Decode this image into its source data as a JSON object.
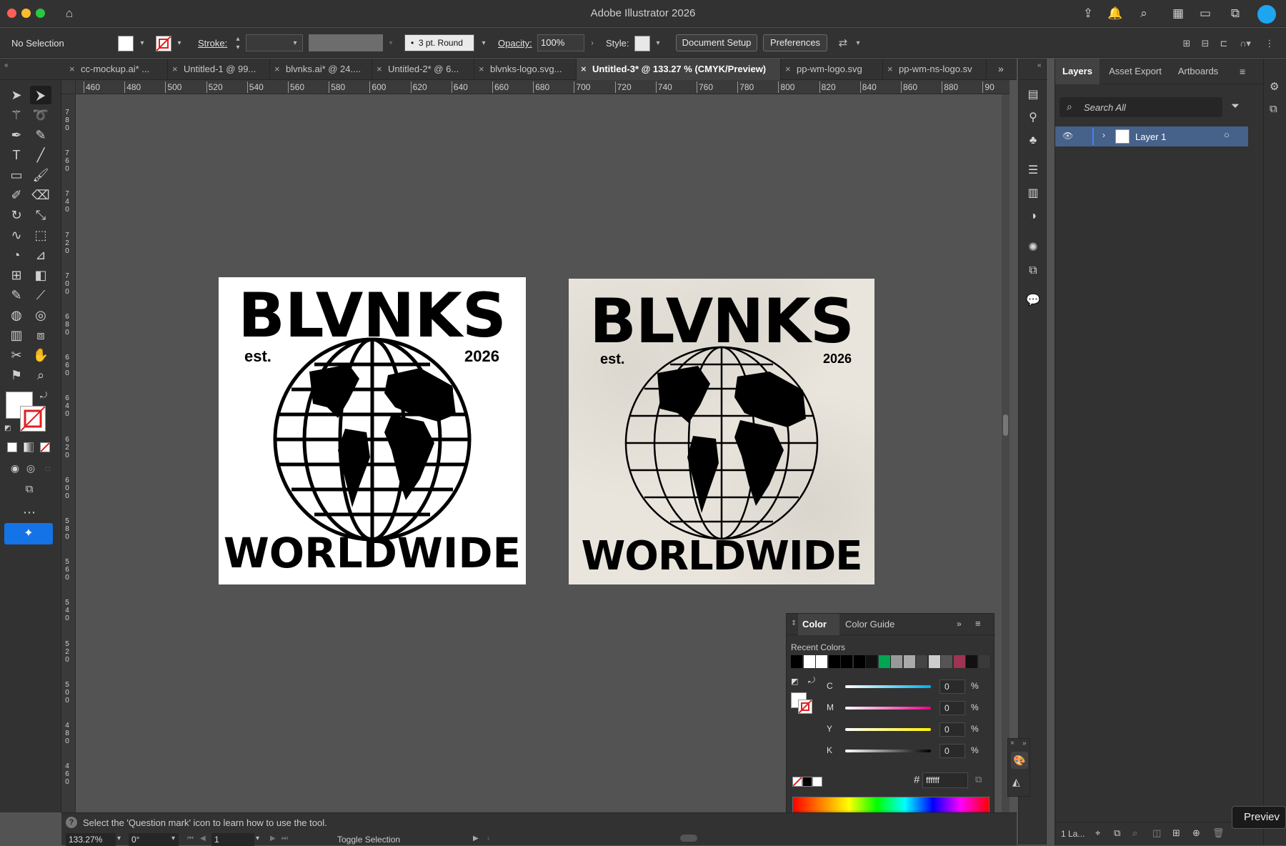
{
  "app": {
    "title": "Adobe Illustrator 2026"
  },
  "controlbar": {
    "selection": "No Selection",
    "stroke_label": "Stroke:",
    "brush": "3 pt. Round",
    "opacity_label": "Opacity:",
    "opacity_value": "100%",
    "style_label": "Style:",
    "document_setup": "Document Setup",
    "preferences": "Preferences"
  },
  "tabs": [
    {
      "label": "cc-mockup.ai* ...",
      "active": false
    },
    {
      "label": "Untitled-1 @ 99...",
      "active": false
    },
    {
      "label": "blvnks.ai* @ 24....",
      "active": false
    },
    {
      "label": "Untitled-2* @ 6...",
      "active": false
    },
    {
      "label": "blvnks-logo.svg...",
      "active": false
    },
    {
      "label": "Untitled-3* @ 133.27 % (CMYK/Preview)",
      "active": true
    },
    {
      "label": "pp-wm-logo.svg",
      "active": false
    },
    {
      "label": "pp-wm-ns-logo.sv",
      "active": false
    }
  ],
  "ruler": {
    "horizontal": [
      "460",
      "480",
      "500",
      "520",
      "540",
      "560",
      "580",
      "600",
      "620",
      "640",
      "660",
      "680",
      "700",
      "720",
      "740",
      "760",
      "780",
      "800",
      "820",
      "840",
      "860",
      "880",
      "90"
    ],
    "vertical": [
      "780",
      "760",
      "740",
      "720",
      "700",
      "680",
      "660",
      "640",
      "620",
      "600",
      "580",
      "560",
      "540",
      "520",
      "500",
      "480",
      "460"
    ]
  },
  "artwork": {
    "left": {
      "brand": "BLVNKS",
      "est": "est.",
      "year": "2026",
      "tagline": "WORLDWIDE"
    },
    "right": {
      "brand": "BLVNKS",
      "est": "est.",
      "year": "2026",
      "tagline": "WORLDWIDE"
    }
  },
  "layers_panel": {
    "tabs": [
      "Layers",
      "Asset Export",
      "Artboards"
    ],
    "search_placeholder": "Search All",
    "layer_name": "Layer 1",
    "footer": "1 La..."
  },
  "color_panel": {
    "tabs": [
      "Color",
      "Color Guide"
    ],
    "recent_label": "Recent Colors",
    "recent_colors": [
      "#000000",
      "#ffffff",
      "#ffffff",
      "#000000",
      "#000000",
      "#000000",
      "#111111",
      "#00a651",
      "#999999",
      "#aaaaaa",
      "#444444",
      "#cccccc",
      "#555555",
      "#9e3454",
      "#111111",
      "#3a3a3a"
    ],
    "sliders": [
      {
        "label": "C",
        "value": "0",
        "unit": "%"
      },
      {
        "label": "M",
        "value": "0",
        "unit": "%"
      },
      {
        "label": "Y",
        "value": "0",
        "unit": "%"
      },
      {
        "label": "K",
        "value": "0",
        "unit": "%"
      }
    ],
    "hex_prefix": "#",
    "hex": "ffffff"
  },
  "statusbar": {
    "hint": "Select the 'Question mark' icon to learn how to use the tool.",
    "zoom": "133.27%",
    "rotation": "0°",
    "artboard": "1",
    "mode": "Toggle Selection"
  },
  "preview_tooltip": "Previev"
}
